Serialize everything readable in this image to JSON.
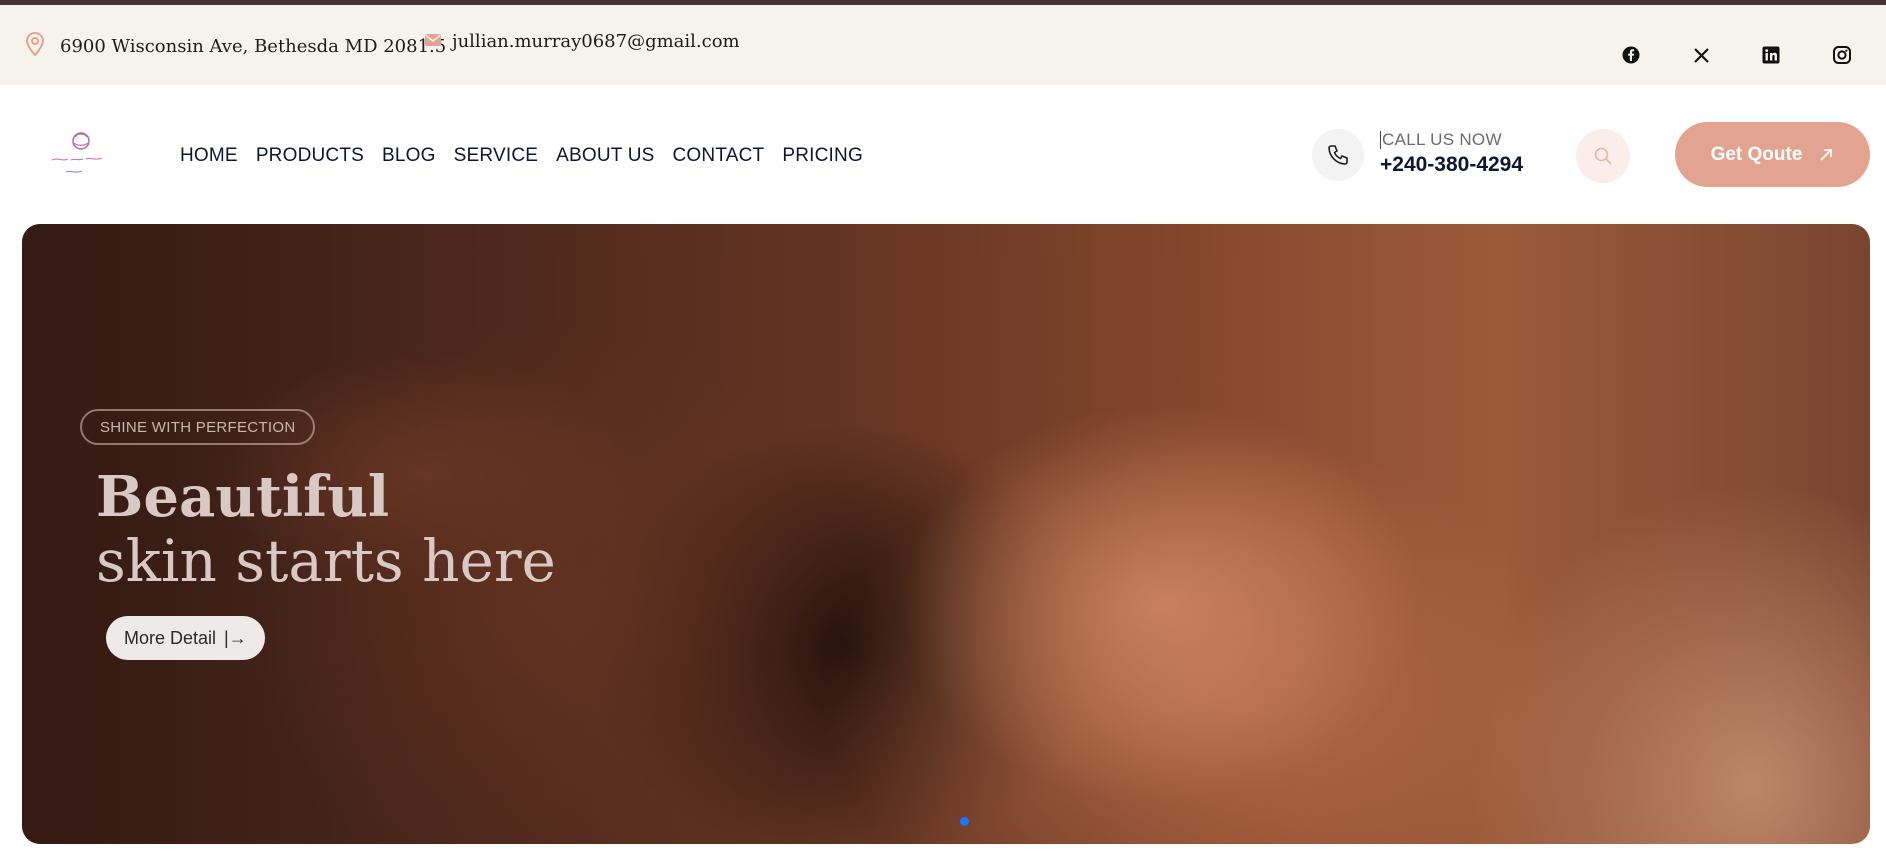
{
  "topbar": {
    "address": "6900 Wisconsin Ave, Bethesda MD 2081.5",
    "email": "jullian.murray0687@gmail.com",
    "social": [
      "facebook-icon",
      "x-icon",
      "linkedin-icon",
      "instagram-icon"
    ]
  },
  "header": {
    "logo_text": "Renew Glow Beauty",
    "nav": [
      "HOME",
      "PRODUCTS",
      "BLOG",
      "SERVICE",
      "ABOUT US",
      "CONTACT",
      "PRICING"
    ],
    "call_label": "CALL US NOW",
    "call_number": "+240-380-4294",
    "quote_label": "Get Qoute"
  },
  "hero": {
    "tagline": "SHINE WITH PERFECTION",
    "title_line1": "Beautiful",
    "title_line2": "skin starts here",
    "button_label": "More Detail",
    "button_icon": "|→"
  },
  "colors": {
    "accent": "#e2a391",
    "topbar_bg": "#f6f2ec",
    "nav_text": "#0f1535",
    "slider_dot": "#1677ff"
  }
}
